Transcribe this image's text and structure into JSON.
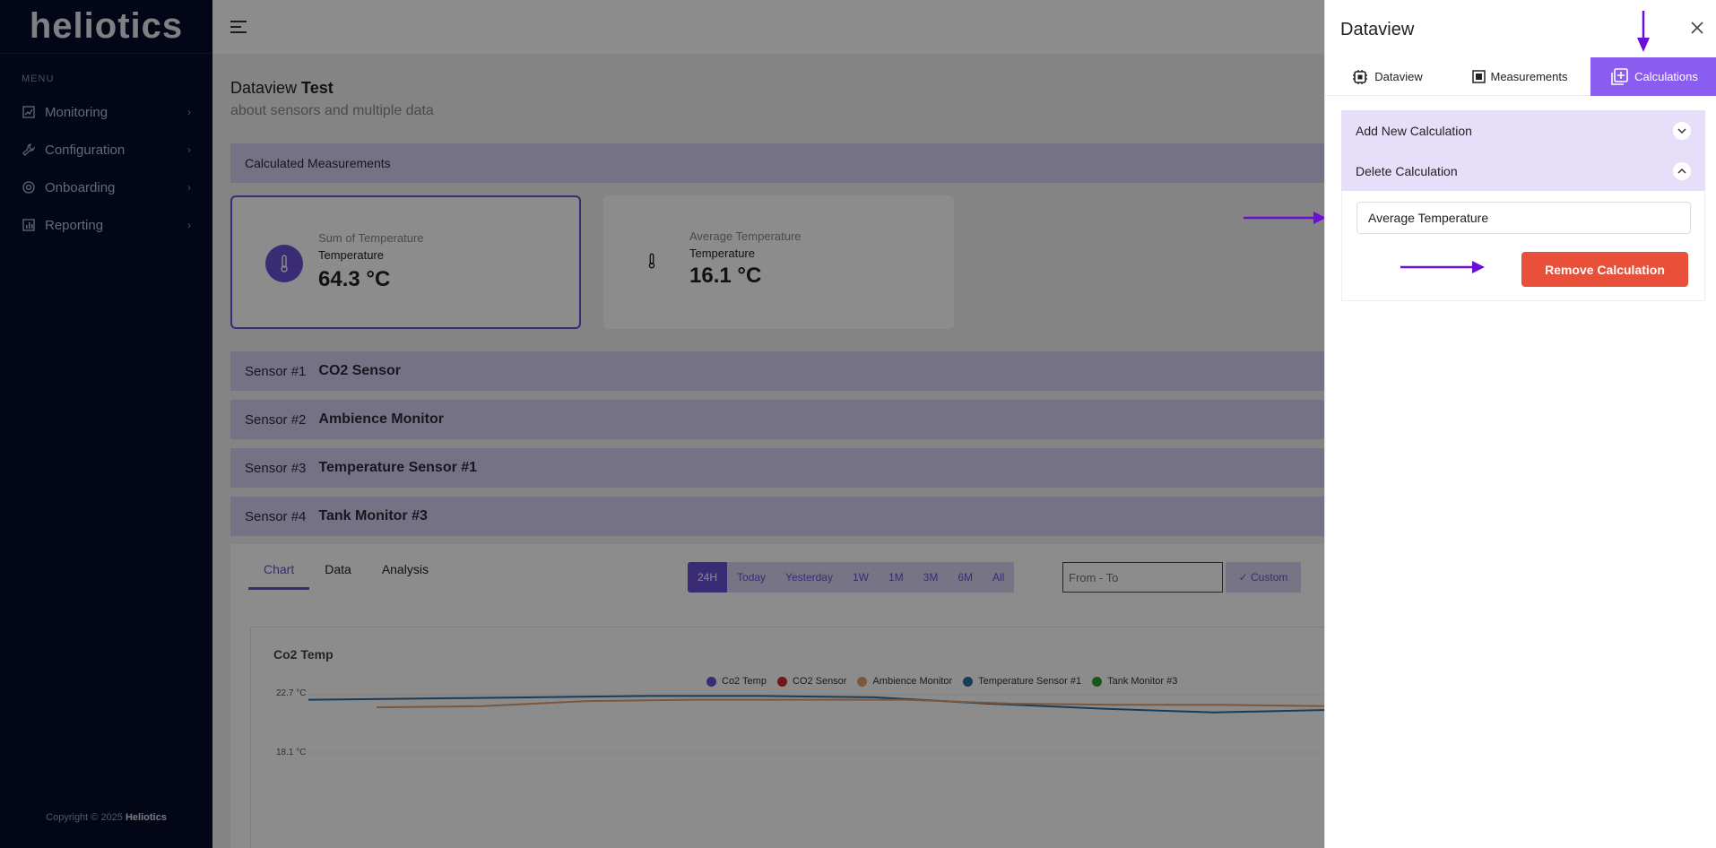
{
  "sidebar": {
    "logo": "heliotics",
    "menu_label": "MENU",
    "items": [
      {
        "label": "Monitoring"
      },
      {
        "label": "Configuration"
      },
      {
        "label": "Onboarding"
      },
      {
        "label": "Reporting"
      }
    ],
    "copyright_prefix": "Copyright © 2025",
    "copyright_brand": "Heliotics"
  },
  "page": {
    "title_prefix": "Dataview",
    "title_name": "Test",
    "subtitle": "about sensors and multiple data",
    "calculated_header": "Calculated Measurements"
  },
  "cards": [
    {
      "title": "Sum of Temperature",
      "measure": "Temperature",
      "value": "64.3 °C"
    },
    {
      "title": "Average Temperature",
      "measure": "Temperature",
      "value": "16.1 °C"
    }
  ],
  "sensors": [
    {
      "num": "Sensor #1",
      "name": "CO2 Sensor"
    },
    {
      "num": "Sensor #2",
      "name": "Ambience Monitor"
    },
    {
      "num": "Sensor #3",
      "name": "Temperature Sensor #1"
    },
    {
      "num": "Sensor #4",
      "name": "Tank Monitor #3"
    }
  ],
  "chart_tabs": [
    "Chart",
    "Data",
    "Analysis"
  ],
  "ranges": [
    "24H",
    "Today",
    "Yesterday",
    "1W",
    "1M",
    "3M",
    "6M",
    "All"
  ],
  "date_placeholder": "From - To",
  "custom_label": "✓ Custom",
  "chart": {
    "title": "Co2 Temp",
    "legend": [
      {
        "name": "Co2 Temp",
        "color": "#6a4fd6"
      },
      {
        "name": "CO2 Sensor",
        "color": "#d62728"
      },
      {
        "name": "Ambience Monitor",
        "color": "#e0a070"
      },
      {
        "name": "Temperature Sensor #1",
        "color": "#2b6fa8"
      },
      {
        "name": "Tank Monitor #3",
        "color": "#2ca02c"
      }
    ],
    "yticks": [
      "22.7 °C",
      "18.1 °C"
    ]
  },
  "chart_data": {
    "type": "line",
    "title": "Co2 Temp",
    "ylim": [
      18.1,
      22.7
    ],
    "series": [
      {
        "name": "Temperature Sensor #1",
        "values": [
          22.3,
          22.4,
          22.5,
          22.6,
          22.6,
          22.5,
          22.0,
          21.6,
          21.3,
          21.5
        ]
      },
      {
        "name": "Ambience Monitor",
        "values": [
          21.7,
          21.8,
          22.2,
          22.3,
          22.3,
          22.3,
          22.0,
          21.9,
          21.9,
          21.8
        ]
      }
    ]
  },
  "drawer": {
    "title": "Dataview",
    "tabs": [
      "Dataview",
      "Measurements",
      "Calculations"
    ],
    "add_label": "Add New Calculation",
    "delete_label": "Delete Calculation",
    "selected_calc": "Average Temperature",
    "remove_label": "Remove Calculation"
  },
  "colors": {
    "accent": "#6a4fd6",
    "drawer_tab": "#8b5cf0",
    "danger": "#e8503a",
    "annotation": "#6a0fd6"
  }
}
